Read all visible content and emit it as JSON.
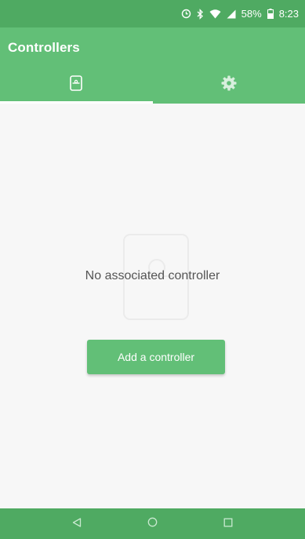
{
  "status_bar": {
    "battery_text": "58%",
    "time": "8:23"
  },
  "app_bar": {
    "title": "Controllers"
  },
  "tabs": [
    {
      "icon": "controller-device-icon",
      "active": true
    },
    {
      "icon": "gear-icon",
      "active": false
    }
  ],
  "empty_state": {
    "message": "No associated controller",
    "button_label": "Add a controller"
  },
  "nav": {
    "back_icon": "back-triangle-icon",
    "home_icon": "home-circle-icon",
    "recents_icon": "recents-square-icon"
  },
  "colors": {
    "status_bar": "#4faa62",
    "accent": "#62bf77",
    "background": "#f7f7f7",
    "text": "#555555"
  }
}
